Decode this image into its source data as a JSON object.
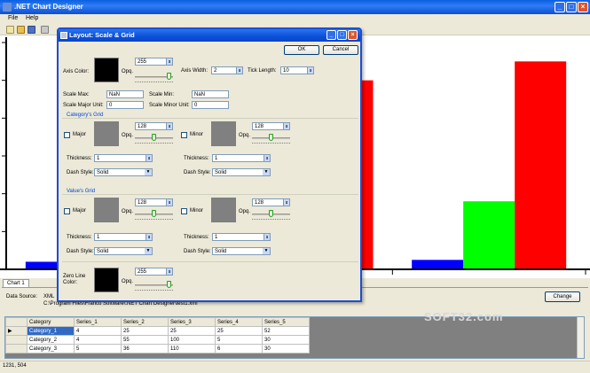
{
  "app": {
    "title": ".NET Chart Designer",
    "menu": [
      "File",
      "Help"
    ]
  },
  "chart_data": {
    "type": "bar",
    "categories": [
      "Category_1",
      "Category_2",
      "Category_3"
    ],
    "series": [
      {
        "values": [
          4,
          4,
          5
        ],
        "color": "#0000ff"
      },
      {
        "values": [
          25,
          55,
          36
        ],
        "color": "#00ff00"
      },
      {
        "values": [
          25,
          100,
          110
        ],
        "color": "#ff0000"
      }
    ],
    "ylim": [
      0,
      120
    ],
    "grid": false
  },
  "bottom": {
    "tab": "Chart 1",
    "data_source_label": "Data Source:",
    "data_source_value_1": "XML",
    "data_source_value_2": "C:\\Program Files\\Franco Software\\.NET Chart Designer\\test1.xml",
    "change_button": "Change",
    "status": "1231, 504"
  },
  "grid": {
    "columns": [
      "Category",
      "Series_1",
      "Series_2",
      "Series_3",
      "Series_4",
      "Series_5"
    ],
    "rows": [
      [
        "Category_1",
        "4",
        "25",
        "25",
        "25",
        "52"
      ],
      [
        "Category_2",
        "4",
        "55",
        "100",
        "5",
        "30"
      ],
      [
        "Category_3",
        "5",
        "36",
        "110",
        "6",
        "30"
      ]
    ]
  },
  "watermark": "SOFT32.com",
  "dialog": {
    "title": "Layout: Scale & Grid",
    "ok": "OK",
    "cancel": "Cancel",
    "axis_color_label": "Axis Color:",
    "opq_label": "Opq.",
    "axis_opacity": "255",
    "axis_width_label": "Axis Width:",
    "axis_width": "2",
    "tick_length_label": "Tick Length:",
    "tick_length": "10",
    "scale_max_label": "Scale Max:",
    "scale_max": "NaN",
    "scale_min_label": "Scale Min:",
    "scale_min": "NaN",
    "scale_major_label": "Scale Major Unit:",
    "scale_major": "0",
    "scale_minor_label": "Scale Minor Unit:",
    "scale_minor": "0",
    "category_grid_title": "Category's Grid",
    "value_grid_title": "Value's Grid",
    "major_label": "Major",
    "minor_label": "Minor",
    "grid_opacity": "128",
    "thickness_label": "Thickness:",
    "thickness": "1",
    "dash_style_label": "Dash Style:",
    "dash_style": "Solid",
    "zero_line_label_1": "Zero Line",
    "zero_line_label_2": "Color:",
    "zero_opacity": "255",
    "colors": {
      "black": "#000000",
      "grey": "#808080"
    }
  }
}
